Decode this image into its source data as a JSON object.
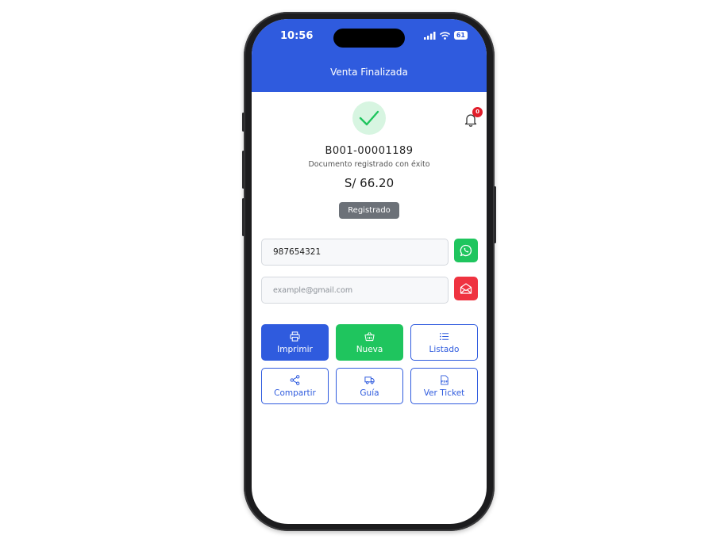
{
  "status_bar": {
    "time": "10:56",
    "battery": "61"
  },
  "header": {
    "title": "Venta Finalizada"
  },
  "notifications": {
    "count": "0"
  },
  "document": {
    "number": "B001-00001189",
    "message": "Documento registrado con éxito",
    "amount": "S/ 66.20",
    "status": "Registrado"
  },
  "contact": {
    "phone_value": "987654321",
    "email_value": "",
    "email_placeholder": "example@gmail.com"
  },
  "actions": {
    "print": "Imprimir",
    "new": "Nueva",
    "list": "Listado",
    "share": "Compartir",
    "guide": "Guía",
    "ticket": "Ver Ticket"
  },
  "colors": {
    "primary": "#2f5bde",
    "success": "#1fc55e",
    "danger": "#ef3340",
    "neutral": "#6c7178"
  }
}
